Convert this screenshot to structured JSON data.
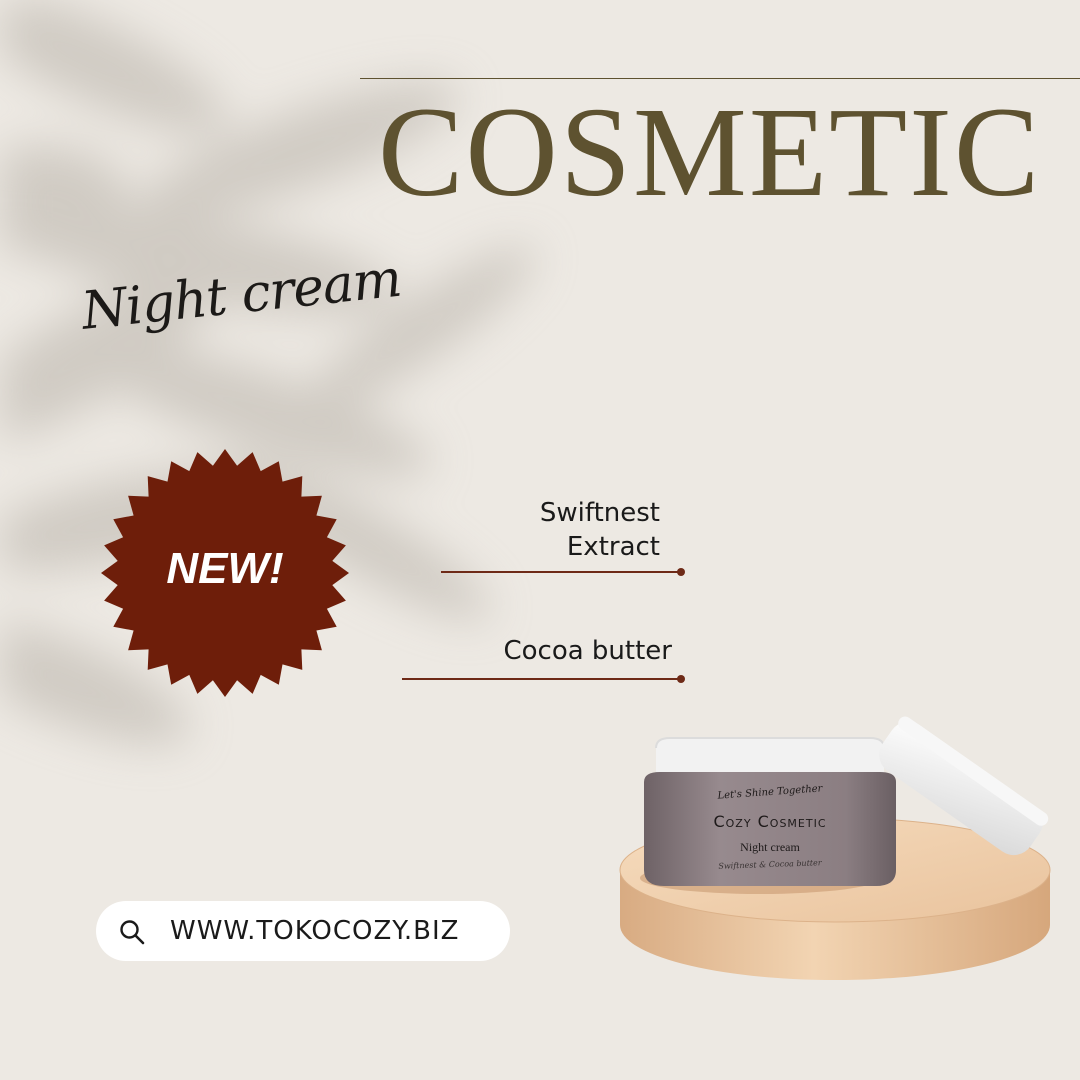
{
  "headline": "COSMETIC",
  "subtitle_script": "Night cream",
  "badge": {
    "label": "NEW!"
  },
  "features": [
    {
      "label_line1": "Swiftnest",
      "label_line2": "Extract"
    },
    {
      "label_line1": "Cocoa butter"
    }
  ],
  "search": {
    "icon": "search-icon",
    "url": "WWW.TOKOCOZY.BIZ"
  },
  "product": {
    "tagline": "Let's Shine Together",
    "brand": "Cozy Cosmetic",
    "variant": "Night cream",
    "ingredients": "Swiftnest & Cocoa butter"
  },
  "colors": {
    "background": "#ede9e3",
    "headline": "#5e5230",
    "badge": "#6e1e0a",
    "accent_line": "#6e2a17",
    "jar_body": "#8d8084",
    "lid": "#ffffff",
    "pedestal": "#e8c49e"
  }
}
